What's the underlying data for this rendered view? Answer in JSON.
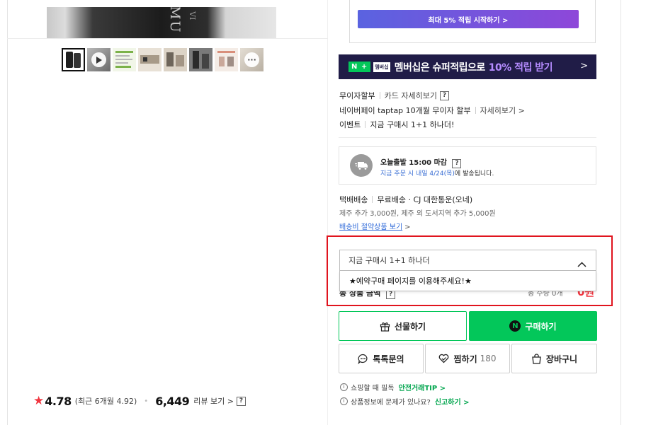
{
  "gallery": {
    "main_image_text": "MU",
    "main_image_subtext": "VI",
    "thumbnails": [
      {
        "kind": "product-dark",
        "bg": "#1f1f1f"
      },
      {
        "kind": "video",
        "bg": "#8a8a8a"
      },
      {
        "kind": "info",
        "bg": "#e9f1dc"
      },
      {
        "kind": "set",
        "bg": "#d9d0c4"
      },
      {
        "kind": "set",
        "bg": "#c9c2b8"
      },
      {
        "kind": "dark",
        "bg": "#6d6d6d"
      },
      {
        "kind": "detail",
        "bg": "#efe4dc"
      },
      {
        "kind": "more",
        "bg": "#d8d2c8"
      }
    ]
  },
  "rating": {
    "score": "4.78",
    "recent": "(최근 6개월 4.92)",
    "review_count": "6,449",
    "review_link": "리뷰 보기",
    "help": "?"
  },
  "promo": {
    "button_label": "최대 5% 적립 시작하기 >"
  },
  "membership_banner": {
    "logo": "N +",
    "tag": "멤버십",
    "text": "멤버십은 슈퍼적립으로",
    "highlight": "10% 적립 받기",
    "arrow": ">",
    "highlight_color": "#b58cff"
  },
  "benefits": {
    "installment_label": "무이자할부",
    "card_detail": "카드 자세히보기",
    "help": "?",
    "taptap": "네이버페이 taptap 10개월 무이자 할부",
    "taptap_detail": "자세히보기 >",
    "event_label": "이벤트",
    "event_text": "지금 구매시 1+1 하나더!"
  },
  "shipping": {
    "title": "오늘출발 15:00 마감",
    "help": "?",
    "sub_blue": "지금 주문 시 내일 4/24(목)",
    "sub_rest": "에 발송됩니다."
  },
  "delivery": {
    "type": "택배배송",
    "detail": "무료배송 · CJ 대한통운(오네)",
    "extra": "제주 추가 3,000원, 제주 외 도서지역 추가 5,000원",
    "save_link": "배송비 절약상품 보기",
    "save_chev": ">"
  },
  "option": {
    "selected": "지금 구매시 1+1 하나더",
    "dropdown_option": "★예약구매 페이지를 이용해주세요!★"
  },
  "total": {
    "label": "총 상품 금액",
    "help": "?",
    "qty": "총 수량 0개",
    "price": "0원"
  },
  "buttons": {
    "gift": "선물하기",
    "buy": "구매하기",
    "buy_icon_letter": "N",
    "talk": "톡톡문의",
    "zzim": "찜하기",
    "zzim_count": "180",
    "cart": "장바구니"
  },
  "notices": {
    "first_text": "쇼핑할 때 필독",
    "first_link": "안전거래TIP >",
    "second_text": "상품정보에 문제가 있나요?",
    "second_link": "신고하기 >",
    "info_glyph": "i"
  },
  "colors": {
    "naver_green": "#03c75a",
    "highlight_red": "#e0141e",
    "rating_star": "#f0353f",
    "banner_bg": "#201c47"
  }
}
